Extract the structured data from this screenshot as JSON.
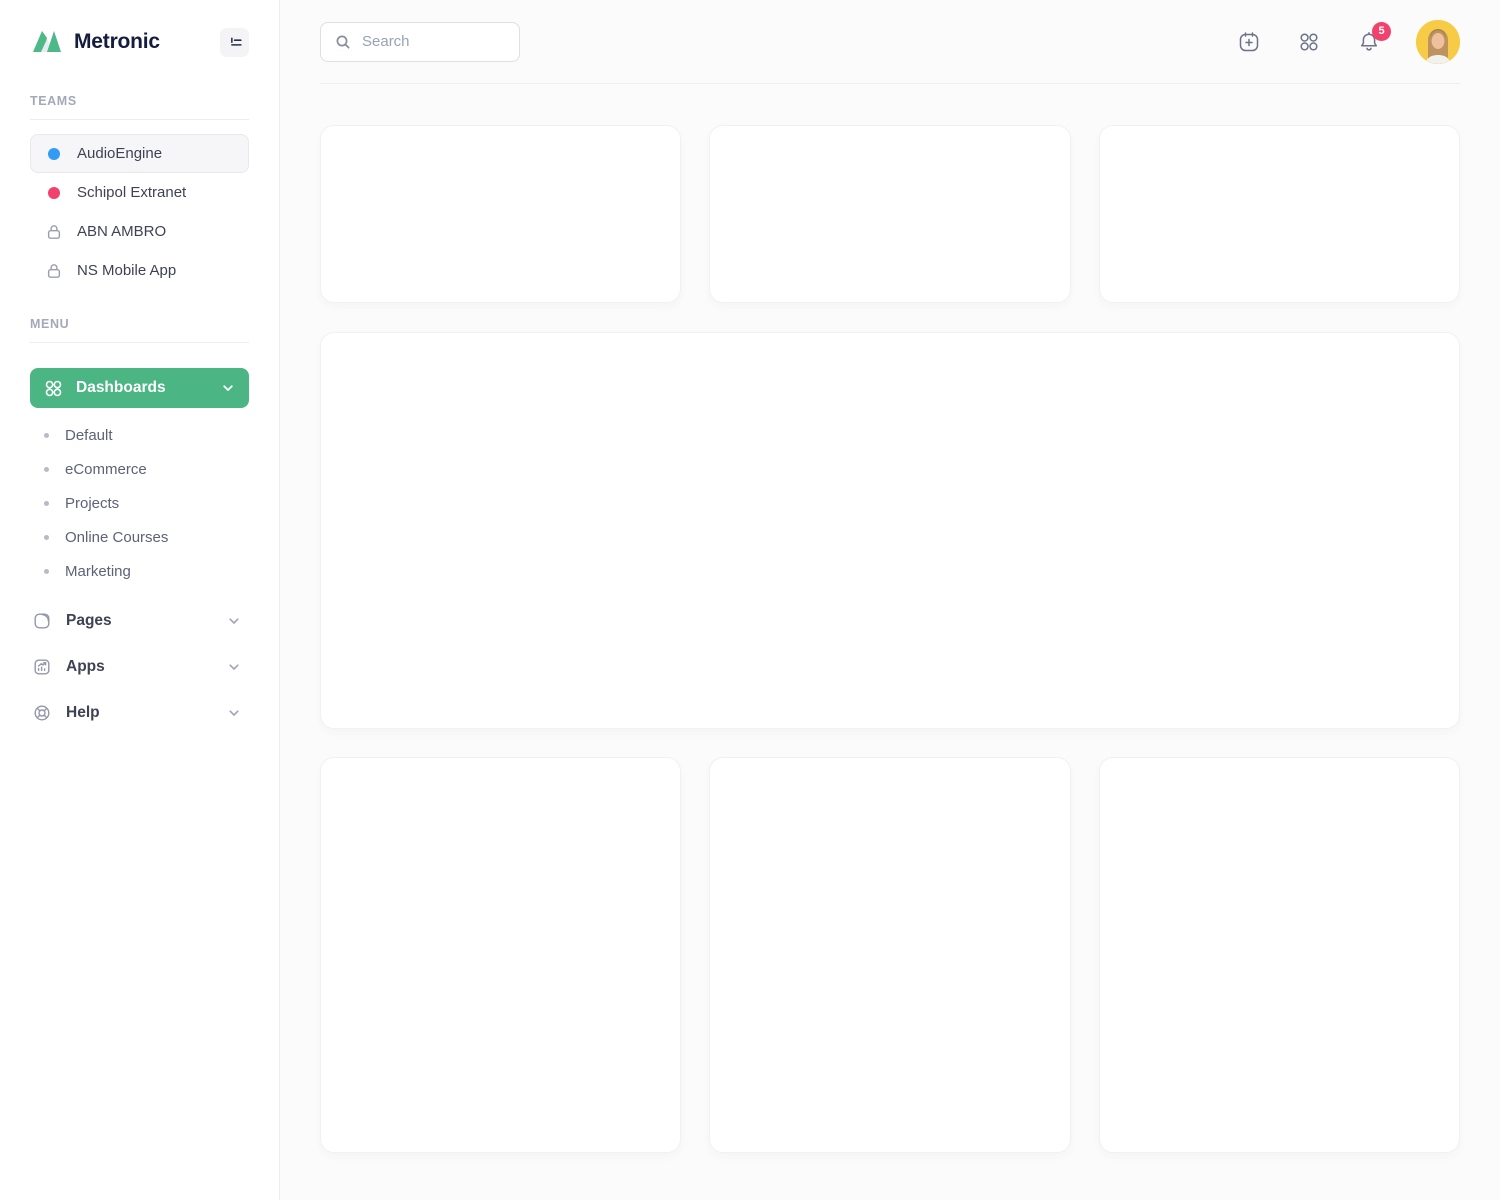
{
  "app": {
    "name": "Metronic"
  },
  "sidebar": {
    "teams_label": "TEAMS",
    "teams": [
      {
        "label": "AudioEngine",
        "indicator": "dot",
        "color": "#329bf5",
        "active": true
      },
      {
        "label": "Schipol Extranet",
        "indicator": "dot",
        "color": "#f1416c",
        "active": false
      },
      {
        "label": "ABN AMBRO",
        "indicator": "lock",
        "active": false
      },
      {
        "label": "NS Mobile App",
        "indicator": "lock",
        "active": false
      }
    ],
    "menu_label": "MENU",
    "dashboards": {
      "label": "Dashboards",
      "active": true,
      "accent_color": "#4bb583"
    },
    "dashboard_items": [
      "Default",
      "eCommerce",
      "Projects",
      "Online Courses",
      "Marketing"
    ],
    "sections": [
      {
        "label": "Pages",
        "icon": "page-icon"
      },
      {
        "label": "Apps",
        "icon": "chart-icon"
      },
      {
        "label": "Help",
        "icon": "lifebuoy-icon"
      }
    ]
  },
  "header": {
    "search_placeholder": "Search",
    "notification_count": "5",
    "badge_color": "#f1416c"
  },
  "content": {
    "cards": {
      "top_row_count": 3,
      "large_row_count": 1,
      "bottom_row_count": 3
    }
  }
}
